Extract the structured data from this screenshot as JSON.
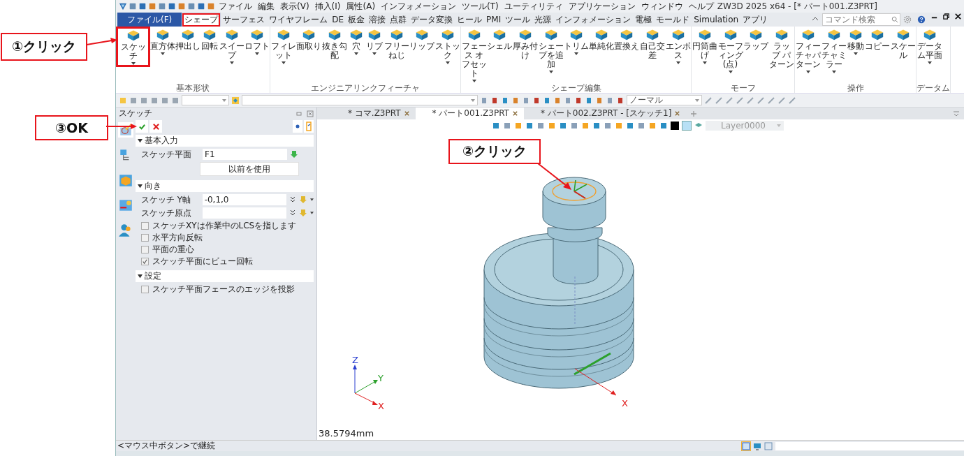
{
  "menu": [
    "ファイル",
    "編集",
    "表示(V)",
    "挿入(I)",
    "属性(A)",
    "インフォメーション",
    "ツール(T)",
    "ユーティリティ",
    "アプリケーション",
    "ウィンドウ",
    "ヘルプ"
  ],
  "window_title": "ZW3D 2025 x64 - [* パート001.Z3PRT]",
  "ribbon_tabs": [
    {
      "label": "ファイル(F)",
      "kind": "file",
      "selected": false,
      "highlighted": false
    },
    {
      "label": "シェープ",
      "kind": "tab",
      "selected": true,
      "highlighted": true
    },
    {
      "label": "サーフェス",
      "kind": "tab",
      "selected": false,
      "highlighted": false
    },
    {
      "label": "ワイヤフレーム",
      "kind": "tab",
      "selected": false,
      "highlighted": false
    },
    {
      "label": "DE",
      "kind": "tab",
      "selected": false,
      "highlighted": false
    },
    {
      "label": "板金",
      "kind": "tab",
      "selected": false,
      "highlighted": false
    },
    {
      "label": "溶接",
      "kind": "tab",
      "selected": false,
      "highlighted": false
    },
    {
      "label": "点群",
      "kind": "tab",
      "selected": false,
      "highlighted": false
    },
    {
      "label": "データ変換",
      "kind": "tab",
      "selected": false,
      "highlighted": false
    },
    {
      "label": "ヒール",
      "kind": "tab",
      "selected": false,
      "highlighted": false
    },
    {
      "label": "PMI",
      "kind": "tab",
      "selected": false,
      "highlighted": false
    },
    {
      "label": "ツール",
      "kind": "tab",
      "selected": false,
      "highlighted": false
    },
    {
      "label": "光源",
      "kind": "tab",
      "selected": false,
      "highlighted": false
    },
    {
      "label": "インフォメーション",
      "kind": "tab",
      "selected": false,
      "highlighted": false
    },
    {
      "label": "電極",
      "kind": "tab",
      "selected": false,
      "highlighted": false
    },
    {
      "label": "モールド",
      "kind": "tab",
      "selected": false,
      "highlighted": false
    },
    {
      "label": "Simulation",
      "kind": "tab",
      "selected": false,
      "highlighted": false
    },
    {
      "label": "アプリ",
      "kind": "tab",
      "selected": false,
      "highlighted": false
    }
  ],
  "command_search": {
    "placeholder": "コマンド検索"
  },
  "ribbon_groups": [
    {
      "label": "基本形状",
      "buttons": [
        {
          "label": "スケッチ",
          "caret": true,
          "highlighted": true
        },
        {
          "label": "直方体",
          "caret": true,
          "highlighted": false
        },
        {
          "label": "押出し",
          "caret": false,
          "highlighted": false
        },
        {
          "label": "回転",
          "caret": false,
          "highlighted": false
        },
        {
          "label": "スイープ",
          "caret": true,
          "highlighted": false
        },
        {
          "label": "ロフト",
          "caret": true,
          "highlighted": false
        }
      ]
    },
    {
      "label": "エンジニアリンクフィーチャ",
      "buttons": [
        {
          "label": "フィレット",
          "caret": true,
          "highlighted": false
        },
        {
          "label": "面取り",
          "caret": false,
          "highlighted": false
        },
        {
          "label": "抜き勾配",
          "caret": false,
          "highlighted": false
        },
        {
          "label": "穴",
          "caret": true,
          "highlighted": false
        },
        {
          "label": "リブ",
          "caret": true,
          "highlighted": false
        },
        {
          "label": "フリーねじ",
          "caret": false,
          "highlighted": false
        },
        {
          "label": "リップ",
          "caret": false,
          "highlighted": false
        },
        {
          "label": "ストック",
          "caret": true,
          "highlighted": false
        }
      ]
    },
    {
      "label": "シェープ編集",
      "buttons": [
        {
          "label": "フェース オフセット",
          "caret": true,
          "highlighted": false
        },
        {
          "label": "シェル",
          "caret": false,
          "highlighted": false
        },
        {
          "label": "厚み付け",
          "caret": false,
          "highlighted": false
        },
        {
          "label": "シェープを追加",
          "caret": true,
          "highlighted": false
        },
        {
          "label": "トリム",
          "caret": true,
          "highlighted": false
        },
        {
          "label": "単純化",
          "caret": false,
          "highlighted": false
        },
        {
          "label": "置換え",
          "caret": false,
          "highlighted": false
        },
        {
          "label": "自己交差",
          "caret": false,
          "highlighted": false
        },
        {
          "label": "エンボス",
          "caret": true,
          "highlighted": false
        }
      ]
    },
    {
      "label": "モーフ",
      "buttons": [
        {
          "label": "円筒曲げ",
          "caret": true,
          "highlighted": false
        },
        {
          "label": "モーフィング(点)",
          "caret": true,
          "highlighted": false
        },
        {
          "label": "ラップ",
          "caret": false,
          "highlighted": false
        },
        {
          "label": "ラップ パターン",
          "caret": false,
          "highlighted": false
        }
      ]
    },
    {
      "label": "操作",
      "buttons": [
        {
          "label": "フィーチャパターン",
          "caret": true,
          "highlighted": false
        },
        {
          "label": "フィーチャミラー",
          "caret": true,
          "highlighted": false
        },
        {
          "label": "移動",
          "caret": true,
          "highlighted": false
        },
        {
          "label": "コピー",
          "caret": false,
          "highlighted": false
        },
        {
          "label": "スケール",
          "caret": false,
          "highlighted": false
        }
      ]
    },
    {
      "label": "データム",
      "buttons": [
        {
          "label": "データム平面",
          "caret": true,
          "highlighted": false
        }
      ]
    }
  ],
  "toolbar": {
    "view_mode": "ノーマル"
  },
  "panel": {
    "title": "スケッチ",
    "sections": [
      {
        "title": "基本入力",
        "expanded": true,
        "rows": [
          {
            "kind": "field",
            "label": "スケッチ平面",
            "value": "F1",
            "options": false
          },
          {
            "kind": "button",
            "label": "以前を使用"
          }
        ]
      },
      {
        "title": "向き",
        "expanded": true,
        "rows": [
          {
            "kind": "field",
            "label": "スケッチ Y軸",
            "value": "-0,1,0",
            "options": true
          },
          {
            "kind": "field",
            "label": "スケッチ原点",
            "options": true
          },
          {
            "kind": "checkbox",
            "label": "スケッチXYは作業中のLCSを指します",
            "checked": false
          },
          {
            "kind": "checkbox",
            "label": "水平方向反転",
            "checked": false
          },
          {
            "kind": "checkbox",
            "label": "平面の重心",
            "checked": false
          },
          {
            "kind": "checkbox",
            "label": "スケッチ平面にビュー回転",
            "checked": true
          }
        ]
      },
      {
        "title": "設定",
        "expanded": true,
        "rows": [
          {
            "kind": "checkbox",
            "label": "スケッチ平面フェースのエッジを投影",
            "checked": false
          }
        ]
      }
    ]
  },
  "document_tabs": [
    {
      "label": "* コマ.Z3PRT",
      "selected": false
    },
    {
      "label": "* パート001.Z3PRT",
      "selected": true
    },
    {
      "label": "* パート002.Z3PRT - [スケッチ1]",
      "selected": false
    }
  ],
  "layer": "Layer0000",
  "viewport": {
    "triad": {
      "z": "Z",
      "y": "Y",
      "x": "X"
    },
    "x_axis_label": "X",
    "measurement": "38.5794mm"
  },
  "status_bar": {
    "hint": "<マウス中ボタン>で継続"
  },
  "annotations": [
    {
      "text": "①クリック"
    },
    {
      "text": "③OK"
    },
    {
      "text": "②クリック"
    }
  ]
}
